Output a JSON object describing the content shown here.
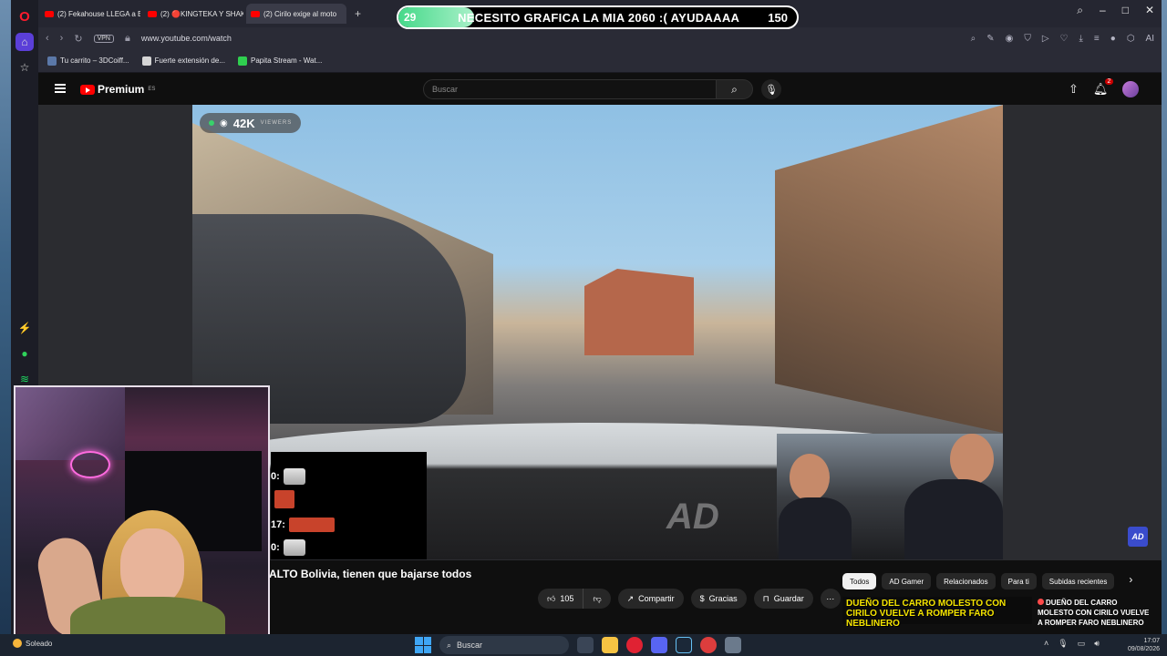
{
  "browser": {
    "tabs": [
      {
        "label": "(2) Fekahouse LLEGA a Bo"
      },
      {
        "label": "(2) 🔴KINGTEKA Y SHAKA"
      },
      {
        "label": "(2) Cirilo exige al moto",
        "active": true
      }
    ],
    "new_tab": "+",
    "vpn_label": "VPN",
    "url": "www.youtube.com/watch",
    "right_label": "AI",
    "bookmarks": [
      {
        "label": "Tu carrito – 3DCoiff..."
      },
      {
        "label": "Fuerte extensión de..."
      },
      {
        "label": "Papita Stream - Wat..."
      }
    ]
  },
  "banner": {
    "left": "29",
    "text": "NECESITO GRAFICA LA MIA 2060 :( AYUDAAAA",
    "right": "150",
    "progress": 0.19
  },
  "youtube": {
    "logo": "Premium",
    "logo_region": "ES",
    "search_placeholder": "Buscar",
    "notifications": "2"
  },
  "video": {
    "viewers": "42K",
    "viewers_label": "VIEWERS",
    "watermark": "AD",
    "corner_logo": "AD"
  },
  "chat": {
    "rows": [
      {
        "prefix": "0:"
      },
      {
        "prefix": ""
      },
      {
        "prefix": "17:"
      },
      {
        "prefix": "0:"
      }
    ]
  },
  "watch": {
    "title": "ALTO Bolivia, tienen que bajarse todos",
    "likes": "105",
    "share": "Compartir",
    "thanks": "Gracias",
    "save": "Guardar",
    "more": "⋯",
    "chips": [
      "Todos",
      "AD Gamer",
      "Relacionados",
      "Para ti",
      "Subidas recientes"
    ],
    "rec_thumb_text": "DUEÑO DEL CARRO MOLESTO CON CIRILO VUELVE A ROMPER FARO NEBLINERO",
    "rec_title": "DUEÑO DEL CARRO MOLESTO CON CIRILO VUELVE A ROMPER FARO NEBLINERO"
  },
  "taskbar": {
    "weather": "Soleado",
    "search": "Buscar",
    "time": "17:07",
    "date": "09/08/2026"
  },
  "colors": {
    "accent": "#5b3fd8",
    "youtube_red": "#ff0000",
    "banner_fill": "#46d98a"
  }
}
